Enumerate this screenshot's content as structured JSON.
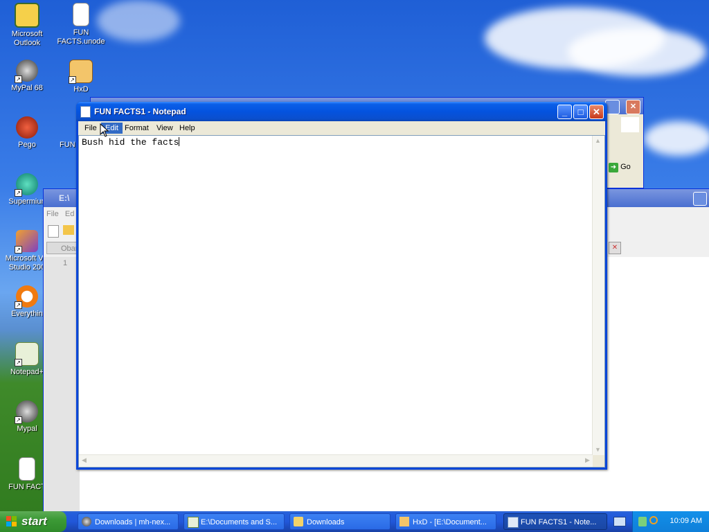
{
  "desktop": {
    "icons": [
      {
        "label": "Microsoft Outlook",
        "icon": "outlook-icon"
      },
      {
        "label": "FUN FACTS.unode",
        "icon": "text-file-icon"
      },
      {
        "label": "MyPal 68",
        "icon": "mypal-icon"
      },
      {
        "label": "HxD",
        "icon": "hxd-icon"
      },
      {
        "label": "Pego",
        "icon": "pego-icon"
      },
      {
        "label": "FUN",
        "icon": "text-file-icon"
      },
      {
        "label": "Supermiun",
        "icon": "supermium-icon"
      },
      {
        "label": "Microsoft Vis Studio 200",
        "icon": "visual-studio-icon"
      },
      {
        "label": "Everythin",
        "icon": "everything-search-icon"
      },
      {
        "label": "Notepad+",
        "icon": "notepad-plus-icon"
      },
      {
        "label": "Mypal",
        "icon": "mypal-icon"
      },
      {
        "label": "FUN FACT",
        "icon": "text-file-icon"
      }
    ]
  },
  "background_windows": {
    "editor": {
      "title": "E:\\",
      "menu_file": "File",
      "menu_edit": "Ed",
      "tab": "Oban",
      "line_number": "1"
    },
    "browser": {
      "go_label": "Go"
    }
  },
  "notepad": {
    "title": "FUN FACTS1 - Notepad",
    "menu": [
      "File",
      "Edit",
      "Format",
      "View",
      "Help"
    ],
    "active_menu": "Edit",
    "content": "Bush hid the facts",
    "buttons": {
      "minimize": "_",
      "maximize": "□",
      "close": "✕"
    }
  },
  "taskbar": {
    "start_label": "start",
    "tasks": [
      {
        "label": "Downloads | mh-nex...",
        "icon": "mypal-icon",
        "active": false
      },
      {
        "label": "E:\\Documents and S...",
        "icon": "notepad-plus-icon",
        "active": false
      },
      {
        "label": "Downloads",
        "icon": "folder-icon",
        "active": false
      },
      {
        "label": "HxD - [E:\\Document...",
        "icon": "hxd-icon",
        "active": false
      },
      {
        "label": "FUN FACTS1 - Note...",
        "icon": "notepad-icon",
        "active": true
      }
    ],
    "clock": "10:09 AM"
  },
  "colors": {
    "title_blue": "#0453df",
    "taskbar_blue": "#245edb",
    "start_green": "#3c9a36",
    "menu_highlight": "#316ac5"
  }
}
